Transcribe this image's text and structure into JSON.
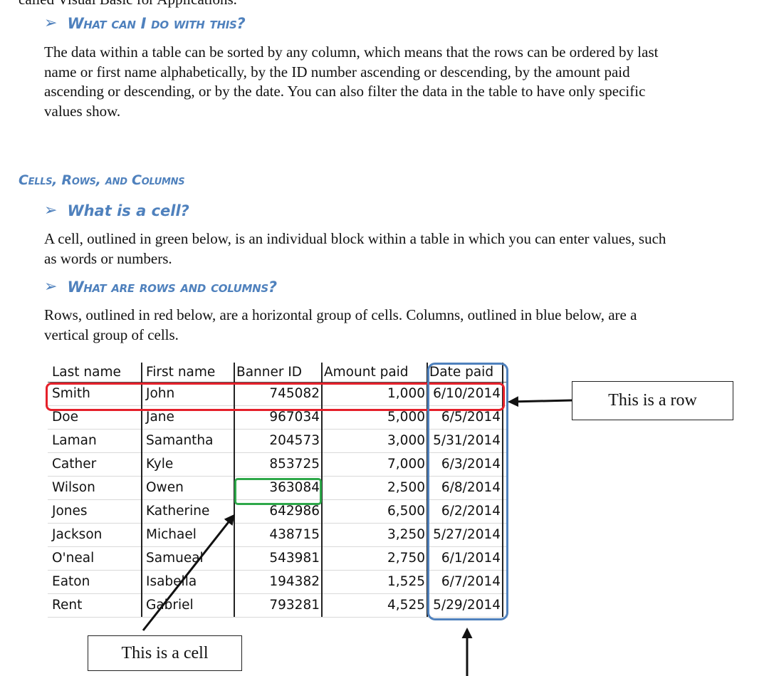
{
  "doc": {
    "top_cutoff_text": "called Visual Basic for Applications.",
    "sections": {
      "what_can_i_do": {
        "heading": "What can I do with this?",
        "paragraph_lines": [
          "The data within a table can be sorted by any column, which means that the rows can be ordered by last",
          "name or first name alphabetically, by the ID number ascending or descending, by the amount paid",
          "ascending or descending, or by the date. You can also filter the data in the table to have only specific",
          "values show."
        ]
      },
      "cells_rows_columns": {
        "heading": "Cells, Rows, and Columns"
      },
      "what_is_a_cell": {
        "heading": "What is a cell?",
        "paragraph_lines": [
          "A cell, outlined in green below, is an individual block within a table in which you can enter values, such",
          "as words or numbers."
        ]
      },
      "what_are_rows_and_columns": {
        "heading": "What are rows and columns?",
        "paragraph_lines": [
          "Rows, outlined in red below, are a horizontal group of cells. Columns, outlined in blue below, are a",
          "vertical group of cells."
        ]
      }
    }
  },
  "table": {
    "headers": [
      "Last name",
      "First name",
      "Banner ID",
      "Amount paid",
      "Date paid"
    ],
    "rows": [
      [
        "Smith",
        "John",
        "745082",
        "1,000",
        "6/10/2014"
      ],
      [
        "Doe",
        "Jane",
        "967034",
        "5,000",
        "6/5/2014"
      ],
      [
        "Laman",
        "Samantha",
        "204573",
        "3,000",
        "5/31/2014"
      ],
      [
        "Cather",
        "Kyle",
        "853725",
        "7,000",
        "6/3/2014"
      ],
      [
        "Wilson",
        "Owen",
        "363084",
        "2,500",
        "6/8/2014"
      ],
      [
        "Jones",
        "Katherine",
        "642986",
        "6,500",
        "6/2/2014"
      ],
      [
        "Jackson",
        "Michael",
        "438715",
        "3,250",
        "5/27/2014"
      ],
      [
        "O'neal",
        "Samueal",
        "543981",
        "2,750",
        "6/1/2014"
      ],
      [
        "Eaton",
        "Isabella",
        "194382",
        "1,525",
        "6/7/2014"
      ],
      [
        "Rent",
        "Gabriel",
        "793281",
        "4,525",
        "5/29/2014"
      ]
    ]
  },
  "callouts": {
    "row": "This is a row",
    "cell": "This is a cell"
  },
  "colors": {
    "heading": "#4f81bd",
    "row_outline": "#e5202a",
    "column_outline": "#4f81bd",
    "cell_outline": "#2ea84a"
  }
}
